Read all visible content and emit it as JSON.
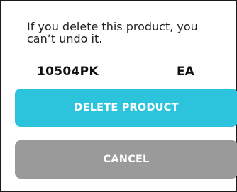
{
  "dialog": {
    "message": "If you delete this product, you can’t undo it.",
    "product": {
      "code": "10504PK",
      "unit": "EA"
    },
    "buttons": {
      "delete_label": "DELETE PRODUCT",
      "cancel_label": "CANCEL"
    }
  },
  "colors": {
    "delete_button": "#2cc3dd",
    "cancel_button": "#9a9a9a"
  }
}
